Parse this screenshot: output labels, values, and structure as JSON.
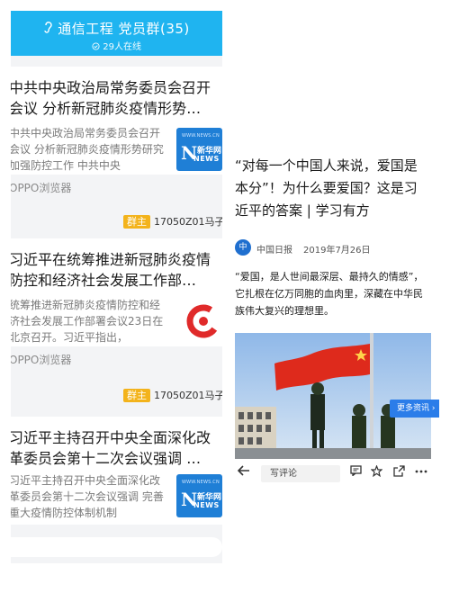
{
  "chat": {
    "group_title": "通信工程 党员群(35)",
    "online_status": "29人在线",
    "cards": [
      {
        "title_lines": [
          "中共中央政治局常务委员会召开",
          "会议 分析新冠肺炎疫情形势…"
        ],
        "summary_lines": [
          "中共中央政治局常务委员会召开",
          "会议 分析新冠肺炎疫情形势研究",
          "加强防控工作 中共中央"
        ],
        "thumb_icon": "xinhua-logo",
        "thumb_top_text": "WWW.NEWS.CN",
        "thumb_brand": "新华网",
        "thumb_ws": "NEWS"
      },
      {
        "title_lines": [
          "习近平在统筹推进新冠肺炎疫情",
          "防控和经济社会发展工作部…"
        ],
        "summary_lines": [
          "统筹推进新冠肺炎疫情防控和经",
          "济社会发展工作部署会议23日在",
          "北京召开。习近平指出，"
        ],
        "thumb_icon": "c-logo"
      },
      {
        "title_lines": [
          "习近平主持召开中央全面深化改",
          "革委员会第十二次会议强调 …"
        ],
        "summary_lines": [
          "习近平主持召开中央全面深化改",
          "革委员会第十二次会议强调 完善",
          "重大疫情防控体制机制"
        ],
        "thumb_icon": "xinhua-logo",
        "thumb_top_text": "WWW.NEWS.CN",
        "thumb_brand": "新华网",
        "thumb_ws": "NEWS"
      }
    ],
    "source_label": "OPPO浏览器",
    "messages": [
      {
        "badge": "群主",
        "sender": "17050Z01马子"
      },
      {
        "badge": "群主",
        "sender": "17050Z01马子"
      }
    ]
  },
  "article": {
    "title_lines": [
      "“对每一个中国人来说，爱国是",
      "本分”！为什么要爱国？这是习",
      "近平的答案 | 学习有方"
    ],
    "publisher": "中国日报",
    "publisher_logo": "中",
    "date": "2019年7月26日",
    "body_lines": [
      "“爱国，是人世间最深层、最持久的情感”，",
      "它扎根在亿万同胞的血肉里，深藏在中华民",
      "族伟大复兴的理想里。"
    ],
    "more_button": "更多资讯 ›",
    "comment_placeholder": "写评论",
    "toolbar_icons": [
      "back-arrow-icon",
      "comment-icon",
      "star-icon",
      "share-icon",
      "more-icon"
    ]
  },
  "colors": {
    "header_blue": "#1fb4f0",
    "badge_orange": "#f3b31b",
    "more_button_blue": "#2b7de9"
  }
}
